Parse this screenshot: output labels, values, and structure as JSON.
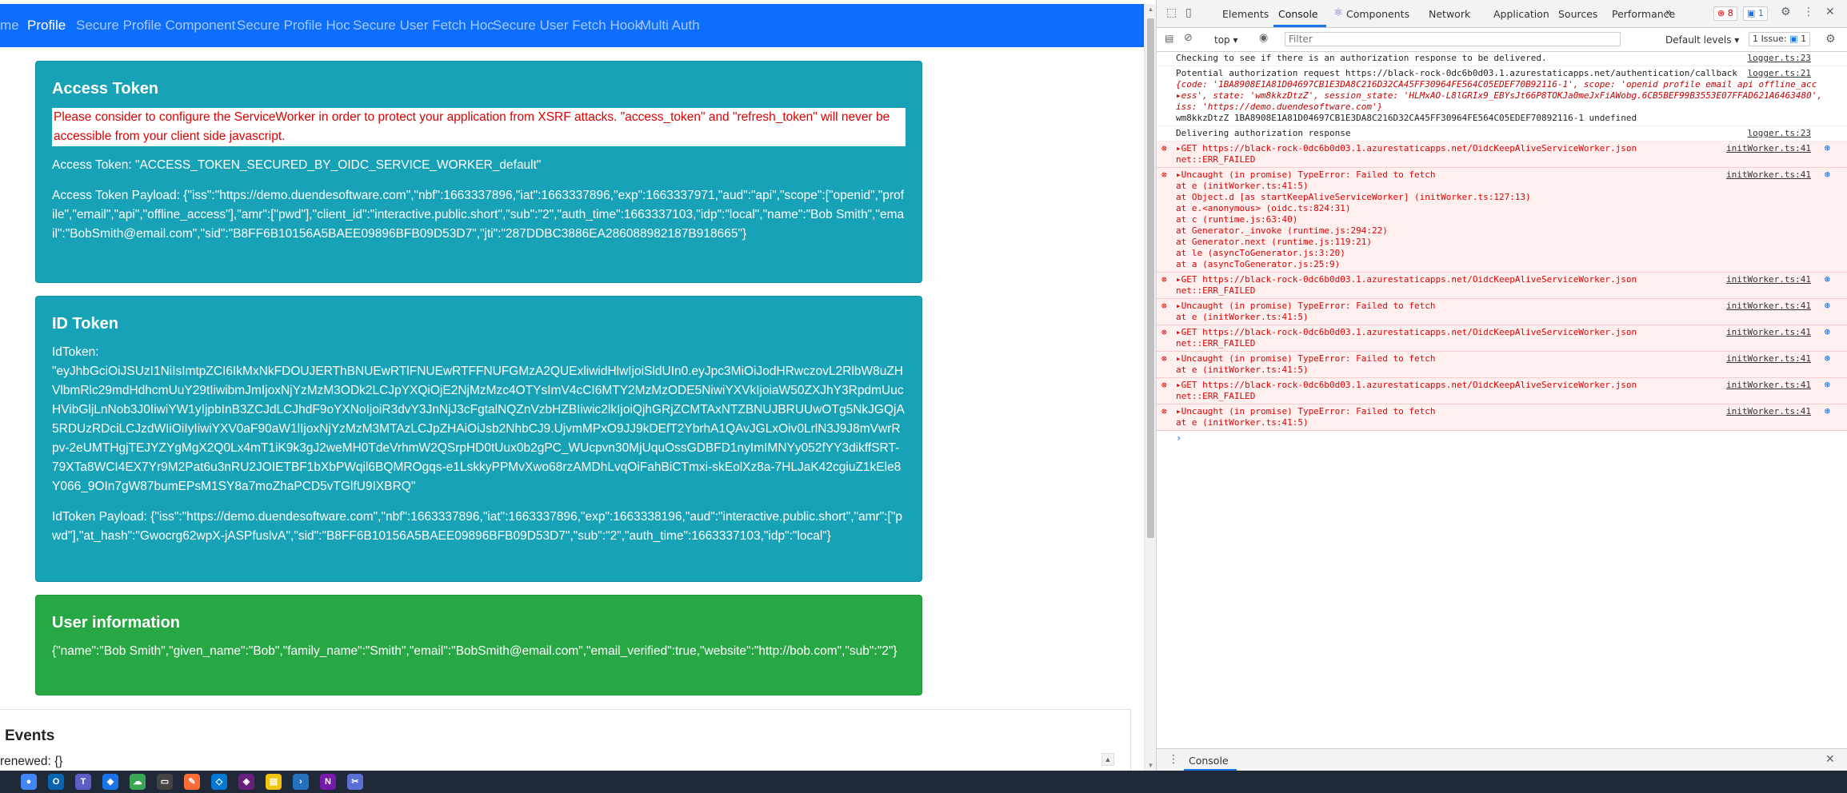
{
  "nav": {
    "items": [
      "me",
      "Profile",
      "Secure Profile Component",
      "Secure Profile Hoc",
      "Secure User Fetch Hoc",
      "Secure User Fetch Hook",
      "Multi Auth"
    ],
    "active": "Profile"
  },
  "access_token_card": {
    "title": "Access Token",
    "warning": "Please consider to configure the ServiceWorker in order to protect your application from XSRF attacks. \"access_token\" and \"refresh_token\" will never be accessible from your client side javascript.",
    "access_token": "Access Token: \"ACCESS_TOKEN_SECURED_BY_OIDC_SERVICE_WORKER_default\"",
    "payload": "Access Token Payload: {\"iss\":\"https://demo.duendesoftware.com\",\"nbf\":1663337896,\"iat\":1663337896,\"exp\":1663337971,\"aud\":\"api\",\"scope\":[\"openid\",\"profile\",\"email\",\"api\",\"offline_access\"],\"amr\":[\"pwd\"],\"client_id\":\"interactive.public.short\",\"sub\":\"2\",\"auth_time\":1663337103,\"idp\":\"local\",\"name\":\"Bob Smith\",\"email\":\"BobSmith@email.com\",\"sid\":\"B8FF6B10156A5BAEE09896BFB09D53D7\",\"jti\":\"287DDBC3886EA286088982187B918665\"}"
  },
  "id_token_card": {
    "title": "ID Token",
    "label": "IdToken:",
    "token": "\"eyJhbGciOiJSUzI1NiIsImtpZCI6IkMxNkFDOUJERThBNUEwRTlFNUEwRTFFNUFGMzA2QUExliwidHlwIjoiSldUIn0.eyJpc3MiOiJodHRwczovL2RlbW8uZHVlbmRlc29mdHdhcmUuY29tIiwibmJmIjoxNjYzMzM3ODk2LCJpYXQiOjE2NjMzMzc4OTYsImV4cCI6MTY2MzMzODE5NiwiYXVkIjoiaW50ZXJhY3RpdmUucHVibGljLnNob3J0IiwiYW1yIjpbInB3ZCJdLCJhdF9oYXNoIjoiR3dvY3JnNjJ3cFgtalNQZnVzbHZBIiwic2lkIjoiQjhGRjZCMTAxNTZBNUJBRUUwOTg5NkJGQjA5RDUzRDciLCJzdWIiOiIyIiwiYXV0aF90aW1lIjoxNjYzMzM3MTAzLCJpZHAiOiJsb2NhbCJ9.UjvmMPxO9JJ9kDEfT2YbrhA1QAvJGLxOiv0LrlN3J9J8mVwrRpv-2eUMTHgjTEJYZYgMgX2Q0Lx4mT1iK9k3gJ2weMH0TdeVrhmW2QSrpHD0tUux0b2gPC_WUcpvn30MjUquOssGDBFD1nyImIMNYy052fYY3dikffSRT-79XTa8WCI4EX7Yr9M2Pat6u3nRU2JOIETBF1bXbPWqil6BQMROgqs-e1LskkyPPMvXwo68rzAMDhLvqOiFahBiCTmxi-skEolXz8a-7HLJaK42cgiuZ1kEle8Y066_9OIn7gW87bumEPsM1SY8a7moZhaPCD5vTGlfU9IXBRQ\"",
    "payload": "IdToken Payload: {\"iss\":\"https://demo.duendesoftware.com\",\"nbf\":1663337896,\"iat\":1663337896,\"exp\":1663338196,\"aud\":\"interactive.public.short\",\"amr\":[\"pwd\"],\"at_hash\":\"Gwocrg62wpX-jASPfuslvA\",\"sid\":\"B8FF6B10156A5BAEE09896BFB09D53D7\",\"sub\":\"2\",\"auth_time\":1663337103,\"idp\":\"local\"}"
  },
  "user_card": {
    "title": "User information",
    "json": "{\"name\":\"Bob Smith\",\"given_name\":\"Bob\",\"family_name\":\"Smith\",\"email\":\"BobSmith@email.com\",\"email_verified\":true,\"website\":\"http://bob.com\",\"sub\":\"2\"}"
  },
  "events": {
    "title": "Events",
    "line": "renewed: {}"
  },
  "devtools": {
    "tabs": [
      "Elements",
      "Console",
      "Components",
      "Network",
      "Application",
      "Sources",
      "Performance"
    ],
    "active_tab": "Console",
    "more": "»",
    "error_count": "8",
    "message_count": "1",
    "issues_label": "1 Issue:",
    "issues_count": "1",
    "context": "top",
    "filter_placeholder": "Filter",
    "levels": "Default levels",
    "drawer_tab": "Console",
    "messages": [
      {
        "type": "log",
        "text": "Checking to see if there is an authorization response to be delivered.",
        "source": "logger.ts:23"
      },
      {
        "type": "log",
        "text": "Potential authorization request  https://black-rock-0dc6b0d03.1.azurestaticapps.net/authentication/callback",
        "source": "logger.ts:21",
        "extra": [
          "{code: '1BA8908E1A81D04697CB1E3DA8C216D32CA45FF30964FE564C05EDEF70B92116-1', scope: 'openid profile email api offline_acc",
          "▸ess', state: 'wm8kkzDtzZ', session_state: 'HLMxAO-L8lGRIx9_EBYsJt66P8TOKJa0meJxFiAWobg.6CB5BEF99B3553E07FFAD621A6463480',",
          "  iss: 'https://demo.duendesoftware.com'}",
          "wm8kkzDtzZ  1BA8908E1A81D04697CB1E3DA8C216D32CA45FF30964FE564C05EDEF70892116-1  undefined"
        ]
      },
      {
        "type": "log",
        "text": "Delivering authorization response",
        "source": "logger.ts:23"
      },
      {
        "type": "error",
        "text": "▸GET https://black-rock-0dc6b0d03.1.azurestaticapps.net/OidcKeepAliveServiceWorker.json",
        "source": "initWorker.ts:41",
        "extra": [
          "net::ERR_FAILED"
        ]
      },
      {
        "type": "error",
        "text": "▸Uncaught (in promise) TypeError: Failed to fetch",
        "source": "initWorker.ts:41",
        "extra": [
          "    at e (initWorker.ts:41:5)",
          "    at Object.d [as startKeepAliveServiceWorker] (initWorker.ts:127:13)",
          "    at e.<anonymous> (oidc.ts:824:31)",
          "    at c (runtime.js:63:40)",
          "    at Generator._invoke (runtime.js:294:22)",
          "    at Generator.next (runtime.js:119:21)",
          "    at le (asyncToGenerator.js:3:20)",
          "    at a (asyncToGenerator.js:25:9)"
        ]
      },
      {
        "type": "error",
        "text": "▸GET https://black-rock-0dc6b0d03.1.azurestaticapps.net/OidcKeepAliveServiceWorker.json",
        "source": "initWorker.ts:41",
        "extra": [
          "net::ERR_FAILED"
        ]
      },
      {
        "type": "error",
        "text": "▸Uncaught (in promise) TypeError: Failed to fetch",
        "source": "initWorker.ts:41",
        "extra": [
          "    at e (initWorker.ts:41:5)"
        ]
      },
      {
        "type": "error",
        "text": "▸GET https://black-rock-0dc6b0d03.1.azurestaticapps.net/OidcKeepAliveServiceWorker.json",
        "source": "initWorker.ts:41",
        "extra": [
          "net::ERR_FAILED"
        ]
      },
      {
        "type": "error",
        "text": "▸Uncaught (in promise) TypeError: Failed to fetch",
        "source": "initWorker.ts:41",
        "extra": [
          "    at e (initWorker.ts:41:5)"
        ]
      },
      {
        "type": "error",
        "text": "▸GET https://black-rock-0dc6b0d03.1.azurestaticapps.net/OidcKeepAliveServiceWorker.json",
        "source": "initWorker.ts:41",
        "extra": [
          "net::ERR_FAILED"
        ]
      },
      {
        "type": "error",
        "text": "▸Uncaught (in promise) TypeError: Failed to fetch",
        "source": "initWorker.ts:41",
        "extra": [
          "    at e (initWorker.ts:41:5)"
        ]
      }
    ],
    "prompt": "›"
  },
  "taskbar": {
    "apps": [
      {
        "icon": "chrome-icon",
        "color": "#4285f4",
        "glyph": "●"
      },
      {
        "icon": "outlook-icon",
        "color": "#0a64ad",
        "glyph": "O"
      },
      {
        "icon": "teams-icon",
        "color": "#5b5fc7",
        "glyph": "T"
      },
      {
        "icon": "maps-icon",
        "color": "#1a73e8",
        "glyph": "◆"
      },
      {
        "icon": "cloud-app-icon",
        "color": "#3aa655",
        "glyph": "☁"
      },
      {
        "icon": "terminal-icon",
        "color": "#444444",
        "glyph": "▭"
      },
      {
        "icon": "postman-icon",
        "color": "#ff6c37",
        "glyph": "✎"
      },
      {
        "icon": "vscode-icon",
        "color": "#0078d4",
        "glyph": "◇"
      },
      {
        "icon": "visual-studio-icon",
        "color": "#68217a",
        "glyph": "◈"
      },
      {
        "icon": "file-explorer-icon",
        "color": "#f1c40f",
        "glyph": "▤"
      },
      {
        "icon": "powershell-icon",
        "color": "#2671be",
        "glyph": "›"
      },
      {
        "icon": "onenote-icon",
        "color": "#7719aa",
        "glyph": "N"
      },
      {
        "icon": "snipping-tool-icon",
        "color": "#5a6fd6",
        "glyph": "✂"
      }
    ]
  }
}
